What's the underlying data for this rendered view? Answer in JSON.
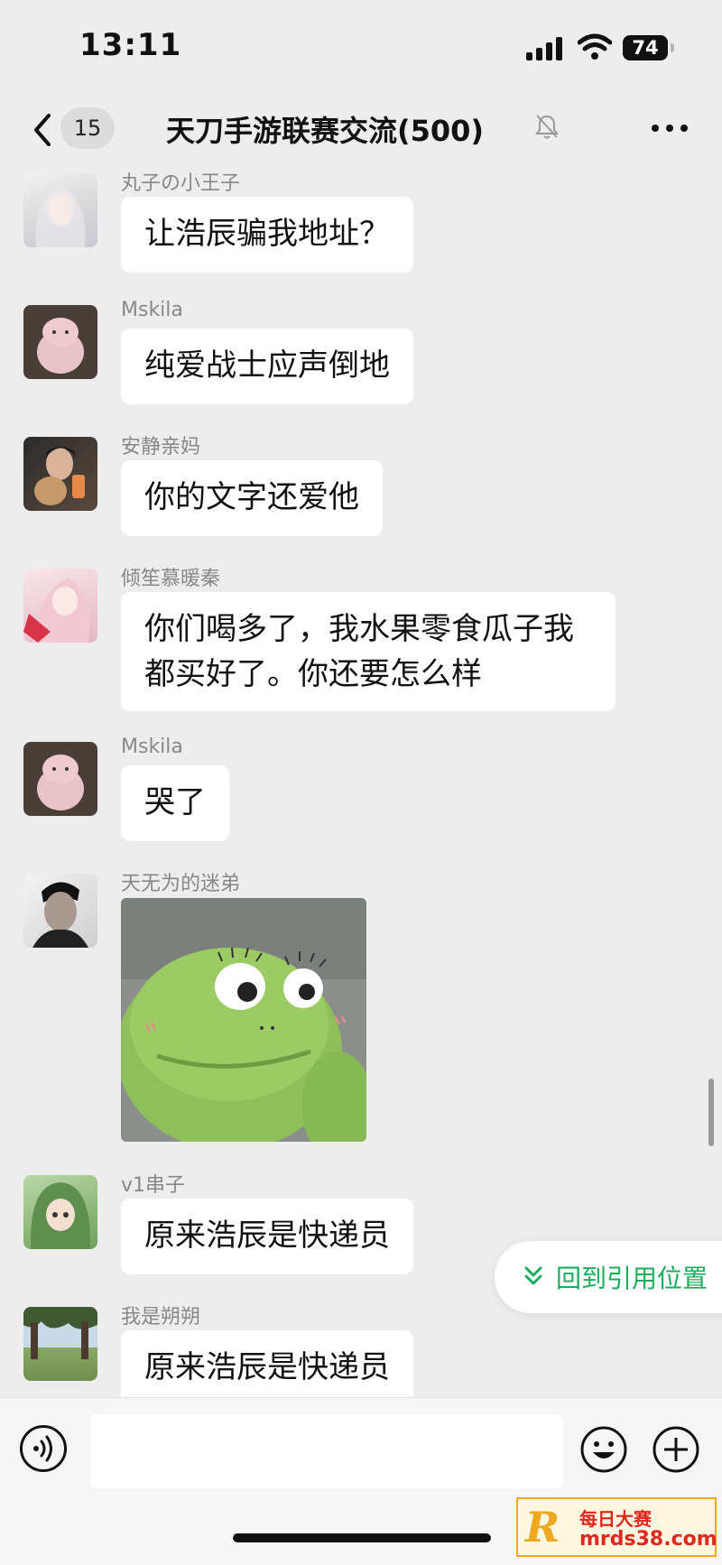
{
  "status_bar": {
    "time": "13:11",
    "battery": "74"
  },
  "nav": {
    "unread_count": "15",
    "title": "天刀手游联赛交流(500)"
  },
  "messages": [
    {
      "sender": "丸子の小王子",
      "text": "让浩辰骗我地址？"
    },
    {
      "sender": "Mskila",
      "text": "纯爱战士应声倒地"
    },
    {
      "sender": "安静亲妈",
      "text": "你的文字还爱他"
    },
    {
      "sender": "倾笙慕暖秦",
      "text_line1": "你们喝多了，我水果零食瓜子我",
      "text_line2": "都买好了。你还要怎么样"
    },
    {
      "sender": "Mskila",
      "text": "哭了"
    },
    {
      "sender": "天无为的迷弟"
    },
    {
      "sender": "v1串子",
      "text": "原来浩辰是快递员"
    },
    {
      "sender": "我是朔朔",
      "text": "原来浩辰是快递员"
    }
  ],
  "jump_button": {
    "label": "回到引用位置"
  },
  "watermark": {
    "brand": "每日大赛",
    "url": "mrds38.com",
    "logo_letter": "R"
  },
  "colors": {
    "background": "#ededed",
    "bubble": "#ffffff",
    "accent_green": "#1aad5b"
  }
}
